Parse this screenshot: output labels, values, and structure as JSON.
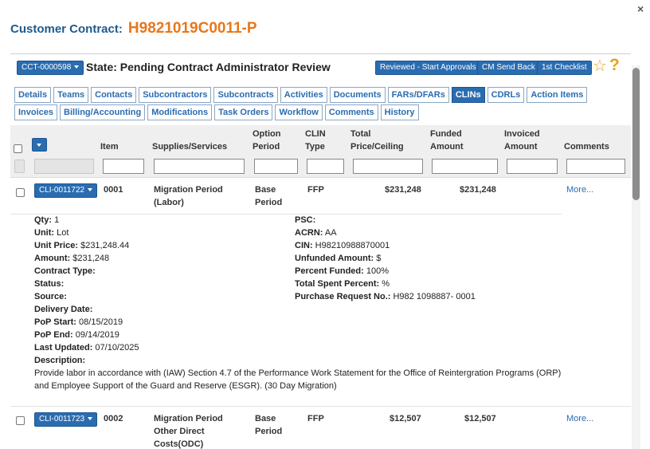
{
  "header": {
    "close_icon": "×",
    "label": "Customer Contract:",
    "contract_number": "H9821019C0011-P"
  },
  "state_bar": {
    "dropdown_label": "CCT-0000598",
    "state_text": "State: Pending Contract Administrator Review",
    "buttons": [
      "Reviewed - Start Approvals",
      "CM Send Back",
      "1st Checklist"
    ],
    "star_icon": "☆",
    "help_icon": "?"
  },
  "tabs": {
    "row1": [
      "Details",
      "Teams",
      "Contacts",
      "Subcontractors",
      "Subcontracts",
      "Activities",
      "Documents",
      "FARs/DFARs",
      "CLINs",
      "CDRLs",
      "Action Items"
    ],
    "row2": [
      "Invoices",
      "Billing/Accounting",
      "Modifications",
      "Task Orders",
      "Workflow",
      "Comments",
      "History"
    ],
    "active": "CLINs"
  },
  "grid": {
    "columns": {
      "item": "Item",
      "supplies": "Supplies/Services",
      "option_1": "Option",
      "option_2": "Period",
      "clin_1": "CLIN",
      "clin_2": "Type",
      "total_1": "Total",
      "total_2": "Price/Ceiling",
      "funded_1": "Funded",
      "funded_2": "Amount",
      "invoiced_1": "Invoiced",
      "invoiced_2": "Amount",
      "comments": "Comments"
    },
    "rows": [
      {
        "clin_button": "CLI-0011722",
        "item": "0001",
        "supplies_1": "Migration Period",
        "supplies_2": "(Labor)",
        "option_1": "Base",
        "option_2": "Period",
        "clin_type": "FFP",
        "total": "$231,248",
        "funded": "$231,248",
        "more": "More..."
      },
      {
        "clin_button": "CLI-0011723",
        "item": "0002",
        "supplies_1": "Migration Period",
        "supplies_2": "Other Direct",
        "supplies_3": "Costs(ODC)",
        "option_1": "Base",
        "option_2": "Period",
        "clin_type": "FFP",
        "total": "$12,507",
        "funded": "$12,507",
        "more": "More..."
      }
    ]
  },
  "details": {
    "qty_label": "Qty:",
    "qty": "1",
    "unit_label": "Unit:",
    "unit": "Lot",
    "unit_price_label": "Unit Price:",
    "unit_price": "$231,248.44",
    "amount_label": "Amount:",
    "amount": "$231,248",
    "contract_type_label": "Contract Type:",
    "status_label": "Status:",
    "source_label": "Source:",
    "delivery_label": "Delivery Date:",
    "pop_start_label": "PoP Start:",
    "pop_start": "08/15/2019",
    "pop_end_label": "PoP End:",
    "pop_end": "09/14/2019",
    "last_updated_label": "Last Updated:",
    "last_updated": "07/10/2025",
    "description_label": "Description:",
    "description": "Provide labor in accordance with (IAW) Section 4.7 of the Performance Work Statement for the Office of Reintergration Programs (ORP) and Employee Support of the Guard and Reserve (ESGR). (30 Day Migration)",
    "psc_label": "PSC:",
    "acrn_label": "ACRN:",
    "acrn": "AA",
    "cin_label": "CIN:",
    "cin": "H98210988870001",
    "unfunded_label": "Unfunded Amount:",
    "unfunded": "$",
    "percent_funded_label": "Percent Funded:",
    "percent_funded": "100%",
    "total_spent_label": "Total Spent Percent:",
    "total_spent": "%",
    "purchase_label": "Purchase Request No.:",
    "purchase": "H982 1098887- 0001"
  }
}
